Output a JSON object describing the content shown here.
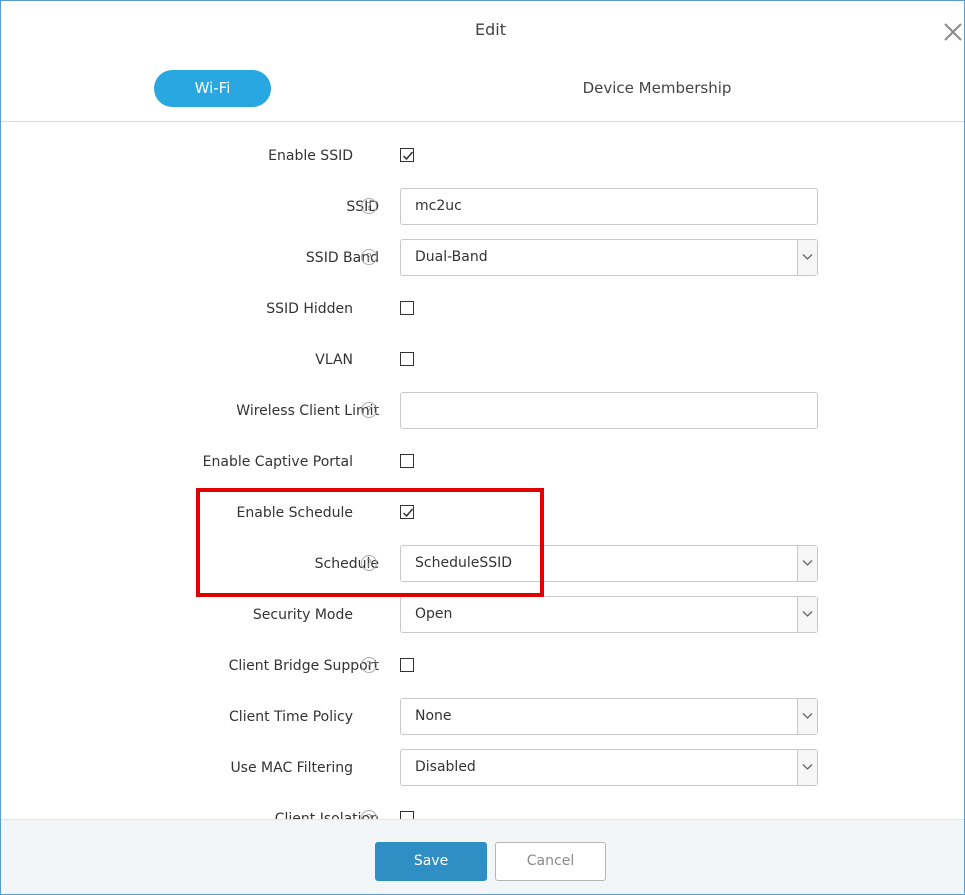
{
  "dialog": {
    "title": "Edit"
  },
  "tabs": {
    "wifi": "Wi-Fi",
    "device_membership": "Device Membership"
  },
  "icons": {
    "help": "?",
    "close": "close-icon",
    "chevron": "chevron-down-icon",
    "check": "check-icon"
  },
  "form": {
    "enable_ssid": {
      "label": "Enable SSID",
      "checked": true
    },
    "ssid": {
      "label": "SSID",
      "value": "mc2uc"
    },
    "ssid_band": {
      "label": "SSID Band",
      "value": "Dual-Band"
    },
    "ssid_hidden": {
      "label": "SSID Hidden",
      "checked": false
    },
    "vlan": {
      "label": "VLAN",
      "checked": false
    },
    "wireless_client_limit": {
      "label": "Wireless Client Limit",
      "value": ""
    },
    "enable_captive_portal": {
      "label": "Enable Captive Portal",
      "checked": false
    },
    "enable_schedule": {
      "label": "Enable Schedule",
      "checked": true
    },
    "schedule": {
      "label": "Schedule",
      "value": "ScheduleSSID"
    },
    "security_mode": {
      "label": "Security Mode",
      "value": "Open"
    },
    "client_bridge_support": {
      "label": "Client Bridge Support",
      "checked": false
    },
    "client_time_policy": {
      "label": "Client Time Policy",
      "value": "None"
    },
    "use_mac_filtering": {
      "label": "Use MAC Filtering",
      "value": "Disabled"
    },
    "client_isolation": {
      "label": "Client Isolation",
      "checked": false
    }
  },
  "footer": {
    "save_label": "Save",
    "cancel_label": "Cancel"
  },
  "colors": {
    "accent": "#29a7e1",
    "save_button": "#2f8fc4",
    "highlight_box": "#e00000",
    "dialog_border": "#5b9bd5"
  }
}
